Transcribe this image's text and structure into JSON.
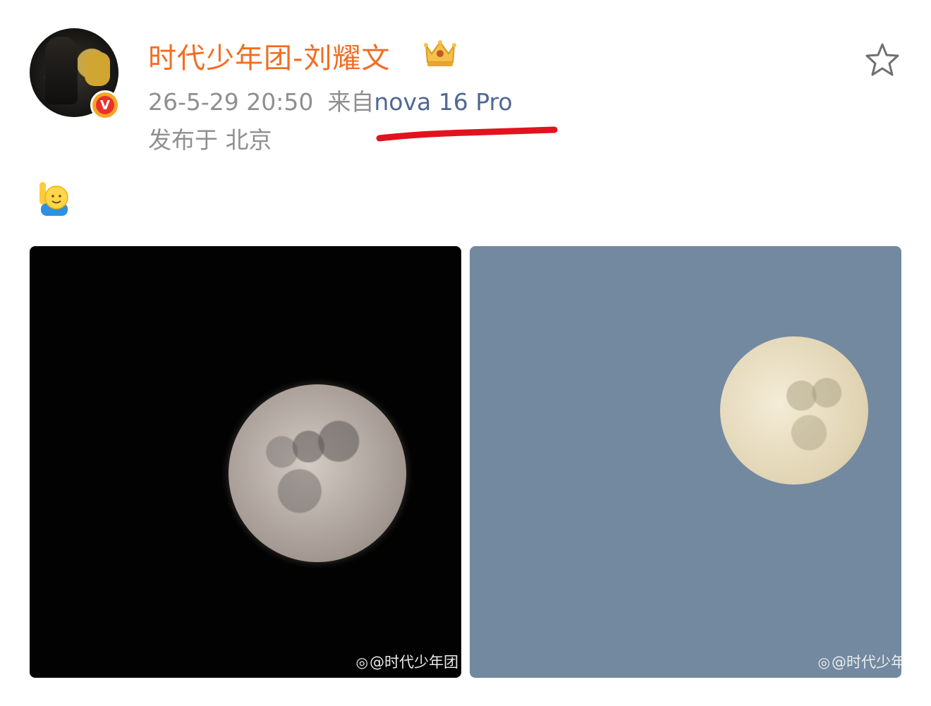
{
  "post": {
    "username": "时代少年团-刘耀文",
    "timestamp": "26-5-29 20:50",
    "source_prefix": "来自",
    "device": "nova 16 Pro",
    "location": "发布于 北京",
    "verified_badge": "V"
  },
  "icons": {
    "avatar": "avatar",
    "verified": "verified-v-badge-icon",
    "crown": "crown-icon",
    "favorite": "star-icon",
    "emoji": "raising-hand-emoji-icon",
    "annotation": "red-underline-annotation"
  },
  "images": [
    {
      "name": "moon-photo-night",
      "background": "#020202",
      "watermark": "@时代少年团"
    },
    {
      "name": "moon-photo-day",
      "background": "#7389a0",
      "watermark": "@时代少年"
    }
  ],
  "colors": {
    "username": "#f26d21",
    "meta": "#8f8f8f",
    "device_link": "#4f6796",
    "underline": "#e0141e"
  }
}
